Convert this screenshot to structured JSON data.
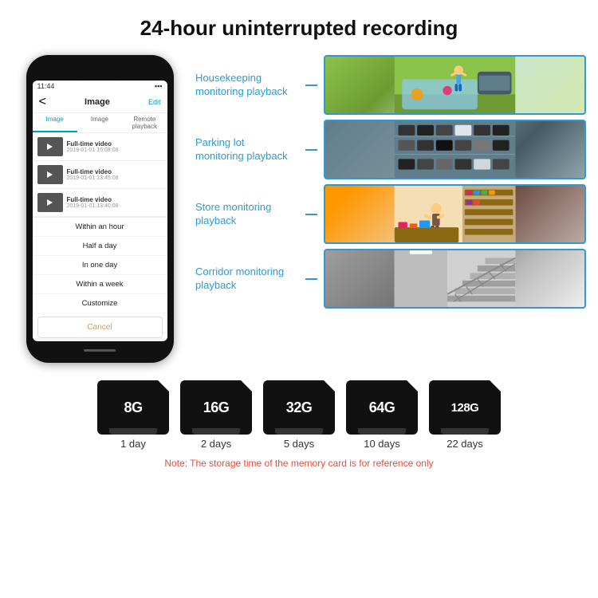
{
  "header": {
    "title": "24-hour uninterrupted recording"
  },
  "phone": {
    "status_time": "11:44",
    "nav_back": "<",
    "nav_title": "Image",
    "nav_edit": "Edit",
    "tabs": [
      "Image",
      "Image",
      "Remote playback"
    ],
    "list_items": [
      {
        "title": "Full-time video",
        "date": "2019-01-01 15:08:08"
      },
      {
        "title": "Full-time video",
        "date": "2019-01-01 13:45:08"
      },
      {
        "title": "Full-time video",
        "date": "2019-01-01 13:40:08"
      }
    ],
    "dropdown_items": [
      "Within an hour",
      "Half a day",
      "In one day",
      "Within a week",
      "Customize"
    ],
    "cancel_label": "Cancel"
  },
  "monitoring": [
    {
      "label": "Housekeeping\nmonitoring playback",
      "photo_type": "housekeeping"
    },
    {
      "label": "Parking lot\nmonitoring playback",
      "photo_type": "parking"
    },
    {
      "label": "Store monitoring\nplayback",
      "photo_type": "store"
    },
    {
      "label": "Corridor monitoring\nplayback",
      "photo_type": "corridor"
    }
  ],
  "sdcards": [
    {
      "size": "8G",
      "days": "1 day"
    },
    {
      "size": "16G",
      "days": "2 days"
    },
    {
      "size": "32G",
      "days": "5 days"
    },
    {
      "size": "64G",
      "days": "10 days"
    },
    {
      "size": "128G",
      "days": "22 days"
    }
  ],
  "note": "Note: The storage time of the memory card is for reference only"
}
